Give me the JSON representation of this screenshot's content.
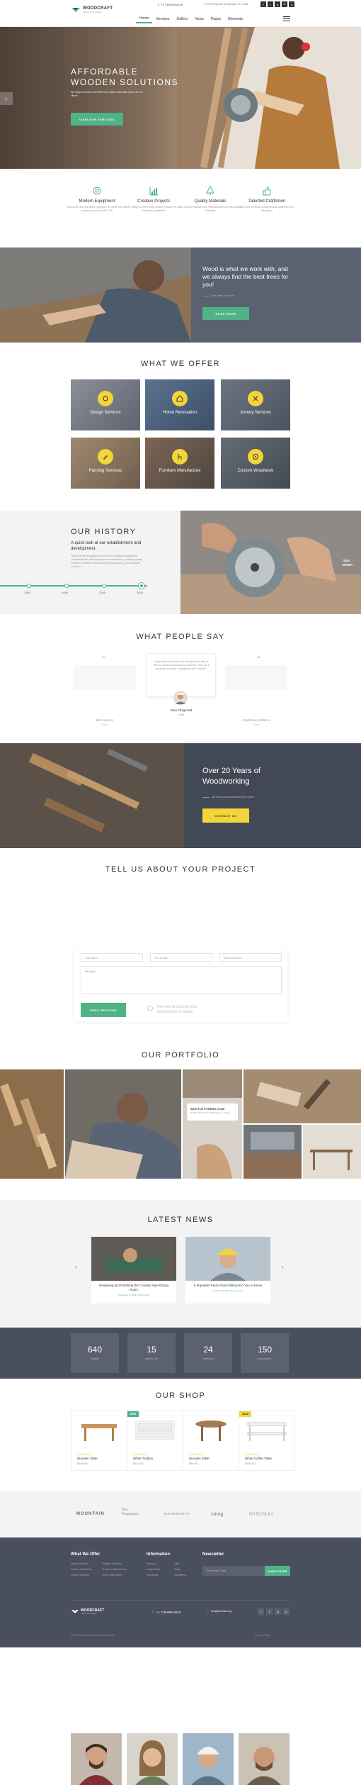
{
  "header": {
    "logo_name": "WOODCRAFT",
    "logo_tagline": "Carpentry Company",
    "phone": "+1 718-999-2019",
    "address": "574 E Reynolds St, Anytown, FL 12345",
    "nav": [
      "Home",
      "Services",
      "Gallery",
      "News",
      "Pages",
      "Elements"
    ],
    "social": [
      "f",
      "t",
      "g",
      "in",
      "p"
    ]
  },
  "hero": {
    "title_line1": "AFFORDABLE",
    "title_line2": "WOODEN SOLUTIONS",
    "subtitle": "We adapt our trees and offer them higher affordable prices for our clients",
    "button": "View Our Services"
  },
  "features": [
    {
      "title": "Modern Equipment",
      "desc": "Woodcraft uses the latest equipment to create the best wooden products in the USA",
      "icon": "gear-icon"
    },
    {
      "title": "Creative Projects",
      "desc": "We design & craft highly creative products for all customers possibilities",
      "icon": "chart-icon"
    },
    {
      "title": "Quality Materials",
      "desc": "Our wooden products are manufactured from high-quality materials",
      "icon": "tree-icon"
    },
    {
      "title": "Talented Craftsmen",
      "desc": "Our team consists of experienced craftsmen and carpenters",
      "icon": "thumbs-up-icon"
    }
  ],
  "banner": {
    "text": "Wood is what we work with, and we always find the best trees for you!",
    "author": "Ben Smith, Founder",
    "button": "Read More"
  },
  "offer": {
    "title": "WHAT WE OFFER",
    "services": [
      "Design Services",
      "Home Renovation",
      "Joinery Services",
      "Painting Services",
      "Furniture Manufacture",
      "Custom Woodwork"
    ]
  },
  "history": {
    "title": "OUR HISTORY",
    "subtitle": "A quick look at our establishment and development.",
    "text": "Today we are recognized as one of the leading woodworking companies with vast equipment and experience, providing quality services in furniture manufacturing, woodworking, and designer solutions.",
    "years": [
      "1980",
      "1995",
      "2006",
      "2016"
    ],
    "side_label1": "OUR",
    "side_label2": "WORK"
  },
  "testimonials": {
    "title": "WHAT PEOPLE SAY",
    "quote": "I have only words of love for Woodcraft for help us with the custom cupboards and shelves. They did a great job and gave us gorgeous new furniture.",
    "people": [
      {
        "name": "Bill Johnson",
        "role": "Client"
      },
      {
        "name": "Sam Fitzgerald",
        "role": "Client"
      },
      {
        "name": "Stephanie Williams",
        "role": "Client"
      }
    ]
  },
  "experience": {
    "title_line1": "Over 20 Years of",
    "title_line2": "Woodworking",
    "subtitle": "We offer quality woodworking for years",
    "button": "Contact Us"
  },
  "project": {
    "title": "TELL US ABOUT YOUR PROJECT",
    "name_ph": "Your Name*",
    "email_ph": "Your E-mail*",
    "service_ph": "Select a Service",
    "message_ph": "Message",
    "button": "Send Message",
    "note": "Feel free to describe your future project in details"
  },
  "portfolio": {
    "title": "OUR PORTFOLIO",
    "caption": "SEATTLE FITNESS CLUB",
    "caption_sub": "Design, Renovation, Manufacture, Joinery"
  },
  "news": {
    "title": "LATEST NEWS",
    "posts": [
      {
        "title": "Designing and Finishing the Country Style Dining Room",
        "meta": "September 8, 2019  |  0 comments"
      },
      {
        "title": "5 Important Facts About Walnut Do You to Know",
        "meta": "October 29, 2019  |  0 comments"
      }
    ]
  },
  "stats": [
    {
      "n": "640",
      "l": "projects"
    },
    {
      "n": "15",
      "l": "awards won"
    },
    {
      "n": "24",
      "l": "craftsmen"
    },
    {
      "n": "150",
      "l": "new projects"
    }
  ],
  "shop": {
    "title": "OUR SHOP",
    "products": [
      {
        "name": "Wooden Table",
        "price": "$100.00",
        "badge": ""
      },
      {
        "name": "White Toolbox",
        "price": "$120.00",
        "badge": "NEW"
      },
      {
        "name": "Wooden Table",
        "price": "$80.00",
        "badge": ""
      },
      {
        "name": "White Coffee Table",
        "price": "$150.00",
        "badge": "SALE"
      }
    ]
  },
  "brands": [
    "MOUNTAIN",
    "Tees Fragrances",
    "WOODWORTH",
    "string",
    "MINIMAL"
  ],
  "footer": {
    "col1_title": "What We Offer",
    "col1a": [
      "Design Services",
      "Custom Woodwork",
      "Joinery Services"
    ],
    "col1b": [
      "Painting Services",
      "Furniture Manufacture",
      "Home Renovation"
    ],
    "col2_title": "Information",
    "col2a": [
      "About us",
      "Latest News",
      "Our Works"
    ],
    "col2b": [
      "FAQ",
      "Shop",
      "Contact Us"
    ],
    "col3_title": "Newsletter",
    "newsletter_ph": "Enter your E-mail",
    "subscribe": "Subscribe",
    "phone": "+1 718-999-2019",
    "email": "info@demolink.org",
    "copyright": "© 2019 WoodCraft. All Rights Reserved",
    "privacy": "Privacy Policy"
  },
  "colors": {
    "accent": "#4fb387",
    "yellow": "#f2d43b",
    "dark": "#4a4f5e"
  }
}
